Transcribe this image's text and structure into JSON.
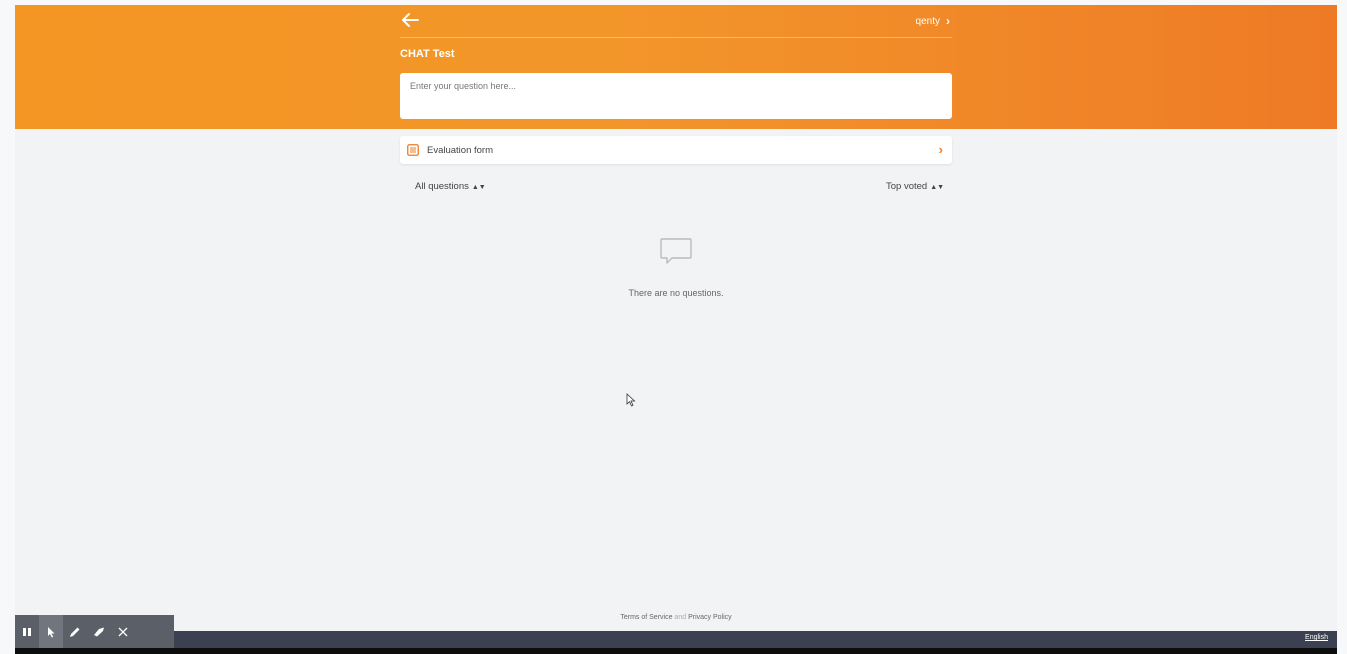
{
  "header": {
    "user_name": "qenty",
    "event_title": "CHAT Test"
  },
  "question_input": {
    "placeholder": "Enter your question here..."
  },
  "evaluation": {
    "label": "Evaluation form"
  },
  "filters": {
    "left": "All questions",
    "right": "Top voted"
  },
  "empty_state": {
    "message": "There are no questions."
  },
  "footer": {
    "terms": "Terms of Service",
    "and": "and",
    "privacy": "Privacy Policy",
    "language": "English"
  },
  "icons": {
    "back": "arrow-left-icon",
    "chevron": "chevron-right-icon",
    "form": "form-list-icon",
    "empty": "chat-bubble-icon",
    "sort": "sort-arrows-icon"
  },
  "colors": {
    "brand_orange": "#f39624",
    "brand_orange_dark": "#ee7a26",
    "bottom_bar": "#3b4150"
  }
}
